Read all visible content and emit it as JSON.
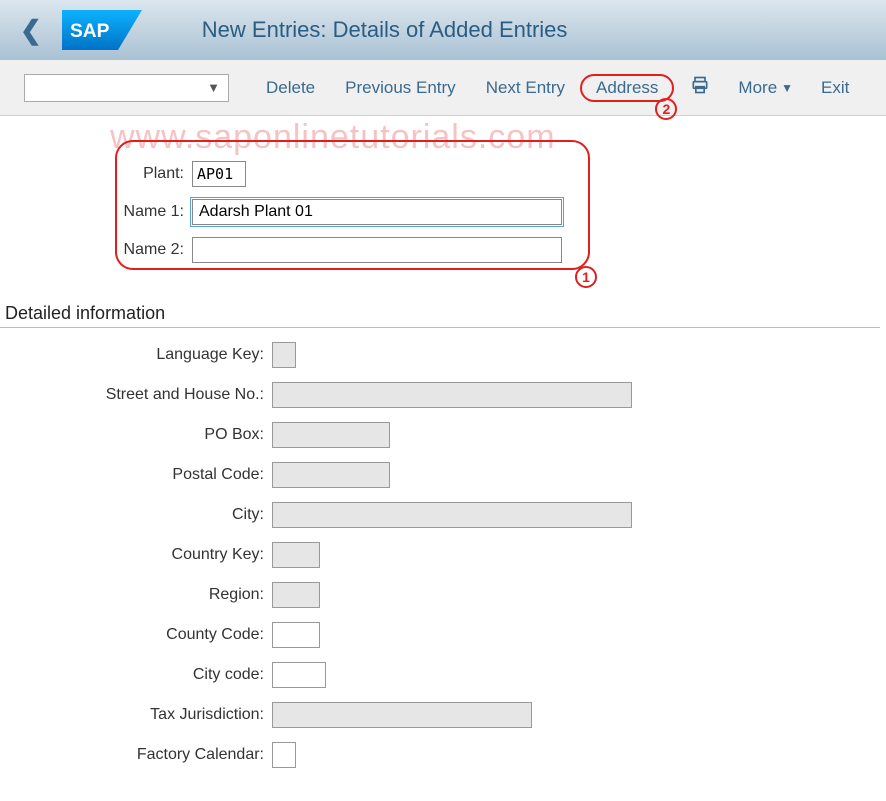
{
  "header": {
    "title": "New Entries: Details of Added Entries"
  },
  "toolbar": {
    "delete": "Delete",
    "previous_entry": "Previous Entry",
    "next_entry": "Next Entry",
    "address": "Address",
    "more": "More",
    "exit": "Exit"
  },
  "watermark": "www.saponlinetutorials.com",
  "callouts": {
    "one": "1",
    "two": "2"
  },
  "form": {
    "plant": {
      "label": "Plant:",
      "value": "AP01"
    },
    "name1": {
      "label": "Name 1:",
      "value": "Adarsh Plant 01"
    },
    "name2": {
      "label": "Name 2:",
      "value": ""
    }
  },
  "section_title": "Detailed information",
  "details": {
    "language_key": {
      "label": "Language Key:",
      "value": ""
    },
    "street_house": {
      "label": "Street and House No.:",
      "value": ""
    },
    "po_box": {
      "label": "PO Box:",
      "value": ""
    },
    "postal_code": {
      "label": "Postal Code:",
      "value": ""
    },
    "city": {
      "label": "City:",
      "value": ""
    },
    "country_key": {
      "label": "Country Key:",
      "value": ""
    },
    "region": {
      "label": "Region:",
      "value": ""
    },
    "county_code": {
      "label": "County Code:",
      "value": ""
    },
    "city_code": {
      "label": "City code:",
      "value": ""
    },
    "tax_jurisdiction": {
      "label": "Tax Jurisdiction:",
      "value": ""
    },
    "factory_calendar": {
      "label": "Factory Calendar:",
      "value": ""
    }
  }
}
